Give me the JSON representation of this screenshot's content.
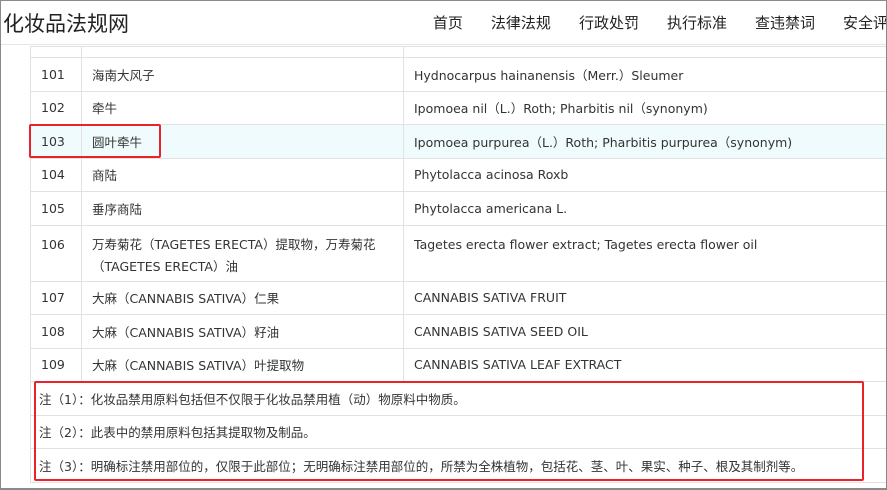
{
  "site": {
    "title": "化妆品法规网",
    "nav": [
      "首页",
      "法律法规",
      "行政处罚",
      "执行标准",
      "查违禁词",
      "安全评"
    ]
  },
  "rows": [
    {
      "no": "101",
      "cn": "海南大风子",
      "en": "Hydnocarpus hainanensis（Merr.）Sleumer"
    },
    {
      "no": "102",
      "cn": "牵牛",
      "en": "Ipomoea nil（L.）Roth; Pharbitis nil（synonym)"
    },
    {
      "no": "103",
      "cn": "圆叶牵牛",
      "en": "Ipomoea purpurea（L.）Roth; Pharbitis purpurea（synonym)"
    },
    {
      "no": "104",
      "cn": "商陆",
      "en": "Phytolacca acinosa Roxb"
    },
    {
      "no": "105",
      "cn": "垂序商陆",
      "en": "Phytolacca americana L."
    },
    {
      "no": "106",
      "cn": "万寿菊花（TAGETES ERECTA）提取物，万寿菊花（TAGETES ERECTA）油",
      "en": "Tagetes erecta flower extract; Tagetes erecta flower oil"
    },
    {
      "no": "107",
      "cn": "大麻（CANNABIS SATIVA）仁果",
      "en": "CANNABIS SATIVA FRUIT"
    },
    {
      "no": "108",
      "cn": "大麻（CANNABIS SATIVA）籽油",
      "en": "CANNABIS SATIVA SEED OIL"
    },
    {
      "no": "109",
      "cn": "大麻（CANNABIS SATIVA）叶提取物",
      "en": "CANNABIS SATIVA LEAF EXTRACT"
    }
  ],
  "notes": [
    "注（1）：化妆品禁用原料包括但不仅限于化妆品禁用植（动）物原料中物质。",
    "注（2）：此表中的禁用原料包括其提取物及制品。",
    "注（3）：明确标注禁用部位的，仅限于此部位；无明确标注禁用部位的，所禁为全株植物，包括花、茎、叶、果实、种子、根及其制剂等。"
  ]
}
